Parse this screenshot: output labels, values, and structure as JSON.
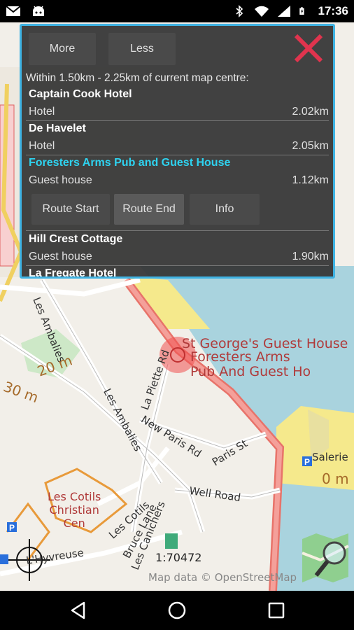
{
  "status": {
    "time": "17:36"
  },
  "map": {
    "pois": {
      "st_georges": "St George's Guest House",
      "foresters_line1": "Foresters Arms",
      "foresters_line2": "Pub And Guest Ho",
      "salerie": "Salerie",
      "church_line1": "Les Cotils",
      "church_line2": "Christian",
      "church_line3": "Cen"
    },
    "roads": {
      "les_ambalies_left": "Les Ambalies",
      "les_ambalies_mid": "Les Ambalies",
      "la_piette": "La Piette Rd",
      "new_paris": "New Paris Rd",
      "paris_st": "Paris St",
      "well_road": "Well Road",
      "les_cotils": "Les Cotils",
      "bruce_lane": "Bruce Lane",
      "les_canichers": "Les Canichers",
      "hyvreuse": "L'Hyvreuse"
    },
    "contours": {
      "c20": "20 m",
      "c30": "30 m",
      "c0": "0 m"
    },
    "scale": "1:70472",
    "attribution": "Map data © OpenStreetMap",
    "colors": {
      "water": "#a9d3de",
      "coast_road": "#e8736a",
      "sand": "#f5e98c"
    }
  },
  "dialog": {
    "more_label": "More",
    "less_label": "Less",
    "header": "Within 1.50km - 2.25km of current map centre:",
    "results": [
      {
        "name": "Captain Cook Hotel",
        "type": "Hotel",
        "distance": "2.02km"
      },
      {
        "name": "De Havelet",
        "type": "Hotel",
        "distance": "2.05km"
      },
      {
        "name": "Foresters Arms Pub and Guest House",
        "type": "Guest house",
        "distance": "1.12km"
      },
      {
        "name": "Hill Crest Cottage",
        "type": "Guest house",
        "distance": "1.90km"
      },
      {
        "name": "La Fregate Hotel",
        "type": "",
        "distance": ""
      }
    ],
    "route_start_label": "Route Start",
    "route_end_label": "Route End",
    "info_label": "Info",
    "accent_color": "#3fb3e3",
    "selected_color": "#2ed3f0"
  }
}
